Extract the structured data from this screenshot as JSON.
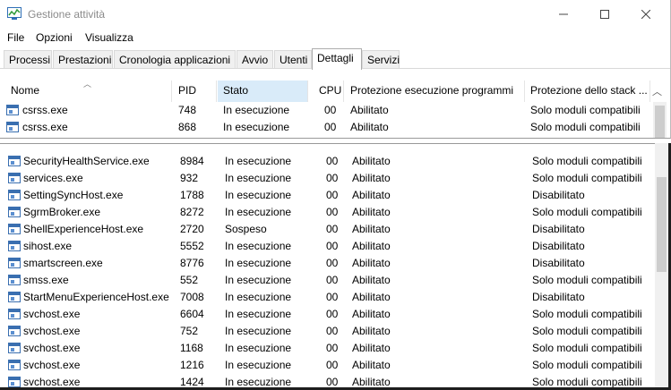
{
  "window": {
    "title": "Gestione attività"
  },
  "menu": [
    "File",
    "Opzioni",
    "Visualizza"
  ],
  "tabs": [
    {
      "label": "Processi",
      "active": false
    },
    {
      "label": "Prestazioni",
      "active": false
    },
    {
      "label": "Cronologia applicazioni",
      "active": false
    },
    {
      "label": "Avvio",
      "active": false
    },
    {
      "label": "Utenti",
      "active": false
    },
    {
      "label": "Dettagli",
      "active": true
    },
    {
      "label": "Servizi",
      "active": false
    }
  ],
  "columns": {
    "name": "Nome",
    "pid": "PID",
    "status": "Stato",
    "cpu": "CPU",
    "dep": "Protezione esecuzione programmi",
    "stack": "Protezione dello stack ..."
  },
  "rows_top": [
    {
      "name": "csrss.exe",
      "pid": "748",
      "status": "In esecuzione",
      "cpu": "00",
      "dep": "Abilitato",
      "stack": "Solo moduli compatibili"
    },
    {
      "name": "csrss.exe",
      "pid": "868",
      "status": "In esecuzione",
      "cpu": "00",
      "dep": "Abilitato",
      "stack": "Solo moduli compatibili"
    }
  ],
  "rows_bottom": [
    {
      "name": "SecurityHealthService.exe",
      "pid": "8984",
      "status": "In esecuzione",
      "cpu": "00",
      "dep": "Abilitato",
      "stack": "Solo moduli compatibili"
    },
    {
      "name": "services.exe",
      "pid": "932",
      "status": "In esecuzione",
      "cpu": "00",
      "dep": "Abilitato",
      "stack": "Solo moduli compatibili"
    },
    {
      "name": "SettingSyncHost.exe",
      "pid": "1788",
      "status": "In esecuzione",
      "cpu": "00",
      "dep": "Abilitato",
      "stack": "Disabilitato"
    },
    {
      "name": "SgrmBroker.exe",
      "pid": "8272",
      "status": "In esecuzione",
      "cpu": "00",
      "dep": "Abilitato",
      "stack": "Solo moduli compatibili"
    },
    {
      "name": "ShellExperienceHost.exe",
      "pid": "2720",
      "status": "Sospeso",
      "cpu": "00",
      "dep": "Abilitato",
      "stack": "Disabilitato"
    },
    {
      "name": "sihost.exe",
      "pid": "5552",
      "status": "In esecuzione",
      "cpu": "00",
      "dep": "Abilitato",
      "stack": "Disabilitato"
    },
    {
      "name": "smartscreen.exe",
      "pid": "8776",
      "status": "In esecuzione",
      "cpu": "00",
      "dep": "Abilitato",
      "stack": "Disabilitato"
    },
    {
      "name": "smss.exe",
      "pid": "552",
      "status": "In esecuzione",
      "cpu": "00",
      "dep": "Abilitato",
      "stack": "Solo moduli compatibili"
    },
    {
      "name": "StartMenuExperienceHost.exe",
      "pid": "7008",
      "status": "In esecuzione",
      "cpu": "00",
      "dep": "Abilitato",
      "stack": "Disabilitato"
    },
    {
      "name": "svchost.exe",
      "pid": "6604",
      "status": "In esecuzione",
      "cpu": "00",
      "dep": "Abilitato",
      "stack": "Solo moduli compatibili"
    },
    {
      "name": "svchost.exe",
      "pid": "752",
      "status": "In esecuzione",
      "cpu": "00",
      "dep": "Abilitato",
      "stack": "Solo moduli compatibili"
    },
    {
      "name": "svchost.exe",
      "pid": "1168",
      "status": "In esecuzione",
      "cpu": "00",
      "dep": "Abilitato",
      "stack": "Solo moduli compatibili"
    },
    {
      "name": "svchost.exe",
      "pid": "1216",
      "status": "In esecuzione",
      "cpu": "00",
      "dep": "Abilitato",
      "stack": "Solo moduli compatibili"
    },
    {
      "name": "svchost.exe",
      "pid": "1424",
      "status": "In esecuzione",
      "cpu": "00",
      "dep": "Abilitato",
      "stack": "Solo moduli compatibili"
    }
  ],
  "colors": {
    "sorted_column_bg": "#d9ebf9",
    "icon_blue": "#3a6fb0"
  },
  "icons": {
    "app": "task-manager-icon",
    "minimize": "minimize-icon",
    "maximize": "maximize-icon",
    "close": "close-icon",
    "sort": "sort-up-icon",
    "process": "process-window-icon"
  }
}
